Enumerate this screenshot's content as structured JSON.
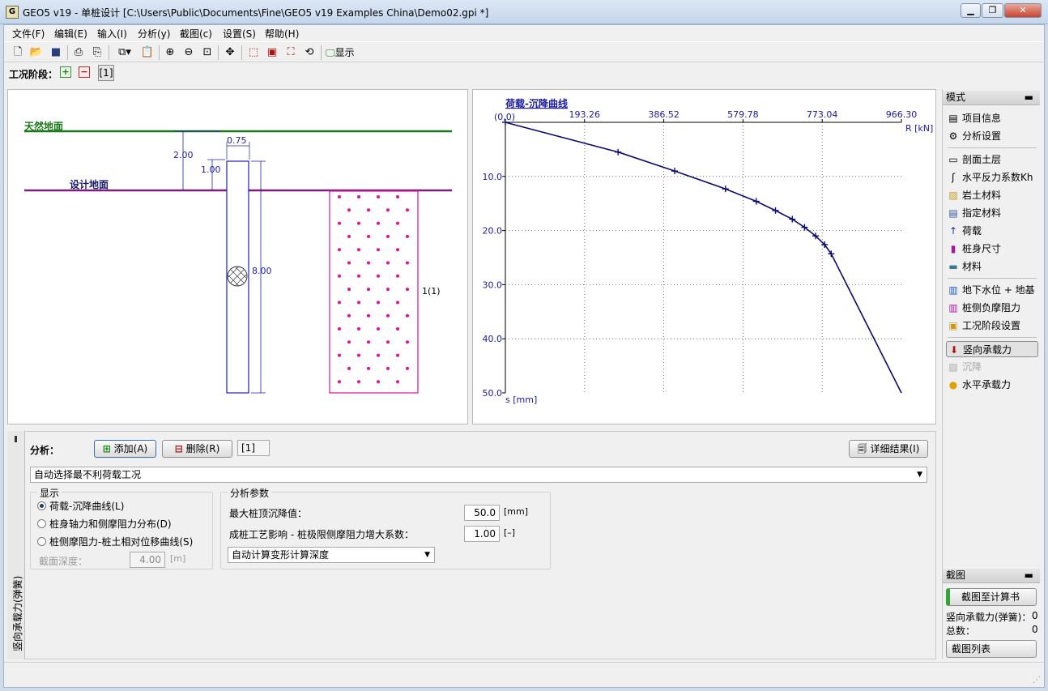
{
  "window": {
    "title": "GEO5 v19 - 单桩设计 [C:\\Users\\Public\\Documents\\Fine\\GEO5 v19 Examples China\\Demo02.gpi *]",
    "app_icon": "G"
  },
  "menu": [
    "文件(F)",
    "编辑(E)",
    "输入(I)",
    "分析(y)",
    "截图(c)",
    "设置(S)",
    "帮助(H)"
  ],
  "toolbar": {
    "display_label": "显示"
  },
  "stage_bar": {
    "label": "工况阶段：",
    "stage": "[1]"
  },
  "drawing": {
    "natural_ground": "天然地面",
    "design_ground": "设计地面",
    "dim_depth": "2.00",
    "dim_width": "0.75",
    "dim_offset": "1.00",
    "dim_length": "8.00",
    "layer_label": "1(1)",
    "colors": {
      "natural": "#1a7a1a",
      "design": "#7a1f7a",
      "pile": "#2020b0",
      "soil": "#e0109a"
    }
  },
  "chart_data": {
    "type": "line",
    "title": "荷载-沉降曲线",
    "origin_label": "(0,0)",
    "xlabel": "R [kN]",
    "ylabel": "s [mm]",
    "x_ticks": [
      "193.26",
      "386.52",
      "579.78",
      "773.04",
      "966.30"
    ],
    "y_ticks": [
      "10.0",
      "20.0",
      "30.0",
      "40.0",
      "50.0"
    ],
    "xlim": [
      0,
      966.3
    ],
    "ylim": [
      0,
      50
    ],
    "grid": true,
    "series": [
      {
        "x": [
          0,
          275,
          413,
          537,
          612,
          659,
          700,
          730,
          757,
          779,
          795,
          966.3
        ],
        "y": [
          0,
          5.5,
          9.0,
          12.3,
          14.6,
          16.3,
          17.9,
          19.4,
          21.0,
          22.6,
          24.3,
          50.0
        ]
      }
    ],
    "color": "#0b0b6e"
  },
  "side_panel": {
    "header": "模式",
    "items": [
      {
        "icon": "info-icon",
        "label": "项目信息"
      },
      {
        "icon": "gear-icon",
        "label": "分析设置"
      },
      {
        "icon": "profile-icon",
        "label": "剖面土层"
      },
      {
        "icon": "spring-icon",
        "label": "水平反力系数Kh"
      },
      {
        "icon": "soil-icon",
        "label": "岩土材料"
      },
      {
        "icon": "assign-icon",
        "label": "指定材料"
      },
      {
        "icon": "load-icon",
        "label": "荷载"
      },
      {
        "icon": "pile-icon",
        "label": "桩身尺寸"
      },
      {
        "icon": "material-icon",
        "label": "材料"
      },
      {
        "icon": "water-icon",
        "label": "地下水位 + 地基"
      },
      {
        "icon": "friction-icon",
        "label": "桩侧负摩阻力"
      },
      {
        "icon": "stage-icon",
        "label": "工况阶段设置"
      },
      {
        "icon": "vertical-capacity-icon",
        "label": "竖向承载力"
      },
      {
        "icon": "settlement-icon",
        "label": "沉降"
      },
      {
        "icon": "horizontal-capacity-icon",
        "label": "水平承载力"
      }
    ],
    "capture_header": "截图",
    "capture_button": "截图至计算书",
    "stat1_label": "竖向承载力(弹簧)：",
    "stat1_value": "0",
    "stat2_label": "总数：",
    "stat2_value": "0",
    "list_button": "截图列表"
  },
  "bottom": {
    "vertical_tab": "竖向承载力(弹簧)",
    "analysis_label": "分析：",
    "add_button": "添加(A)",
    "delete_button": "删除(R)",
    "stage_field": "[1]",
    "detail_button": "详细结果(I)",
    "combo": "自动选择最不利荷载工况",
    "display_group": "显示",
    "radios": [
      "荷载-沉降曲线(L)",
      "桩身轴力和侧摩阻力分布(D)",
      "桩侧摩阻力-桩土相对位移曲线(S)"
    ],
    "section_depth_label": "截面深度：",
    "section_depth_value": "4.00",
    "section_depth_unit": "[m]",
    "params_group": "分析参数",
    "max_settle_label": "最大桩顶沉降值：",
    "max_settle_value": "50.0",
    "max_settle_unit": "[mm]",
    "factor_label": "成桩工艺影响 - 桩极限侧摩阻力增大系数：",
    "factor_value": "1.00",
    "factor_unit": "[–]",
    "depth_select": "自动计算变形计算深度"
  }
}
